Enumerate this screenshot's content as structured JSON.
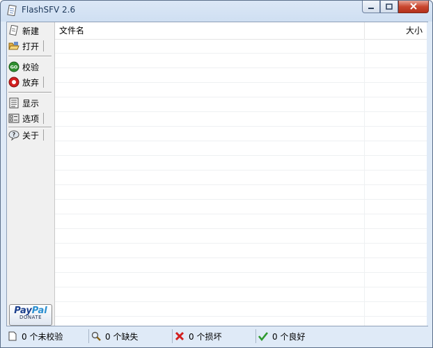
{
  "window": {
    "title": "FlashSFV 2.6"
  },
  "toolbar": {
    "items": [
      {
        "label": "新建",
        "icon": "new-file-icon"
      },
      {
        "label": "打开",
        "icon": "open-folder-icon"
      },
      {
        "label": "校验",
        "icon": "go-icon"
      },
      {
        "label": "放弃",
        "icon": "stop-icon"
      },
      {
        "label": "显示",
        "icon": "document-list-icon"
      },
      {
        "label": "选项",
        "icon": "options-icon"
      },
      {
        "label": "关于",
        "icon": "help-icon"
      }
    ],
    "paypal": {
      "logo_a": "Pay",
      "logo_b": "Pal",
      "donate": "DONATE"
    }
  },
  "list": {
    "columns": [
      "文件名",
      "大小"
    ],
    "rows": []
  },
  "status": {
    "unverified": "0 个未校验",
    "missing": "0 个缺失",
    "damaged": "0 个损坏",
    "good": "0 个良好"
  },
  "colors": {
    "title_text": "#1e395b",
    "close_button": "#c9472f",
    "go_green": "#2f8f2f",
    "stop_red": "#d21f1f",
    "check_green": "#2f9a2f",
    "damage_red": "#d21f1f"
  }
}
